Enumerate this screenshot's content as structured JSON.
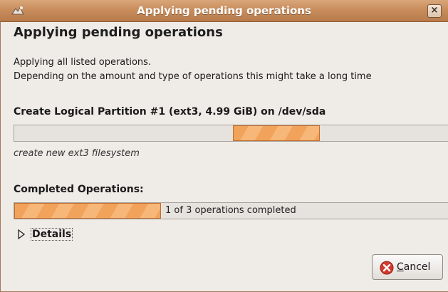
{
  "window": {
    "title": "Applying pending operations",
    "close_glyph": "×",
    "app_icon": "gparted-icon"
  },
  "heading": "Applying pending operations",
  "description": {
    "line1": "Applying all listed operations.",
    "line2": "Depending on the amount and type of operations this might take a long time"
  },
  "current_operation": {
    "title": "Create Logical Partition #1 (ext3, 4.99 GiB) on /dev/sda",
    "subtext": "create new ext3 filesystem",
    "pulse_state": "indeterminate"
  },
  "completed": {
    "title": "Completed Operations:",
    "progress_text": "1 of 3 operations completed",
    "fraction": 0.333
  },
  "details": {
    "label": "Details",
    "expanded": false
  },
  "cancel": {
    "label_mnemonic": "C",
    "label_rest": "ancel",
    "icon": "cancel-icon"
  },
  "colors": {
    "titlebar": "#c98d5c",
    "progress_fill": "#f1a25b",
    "background": "#efebe7"
  }
}
